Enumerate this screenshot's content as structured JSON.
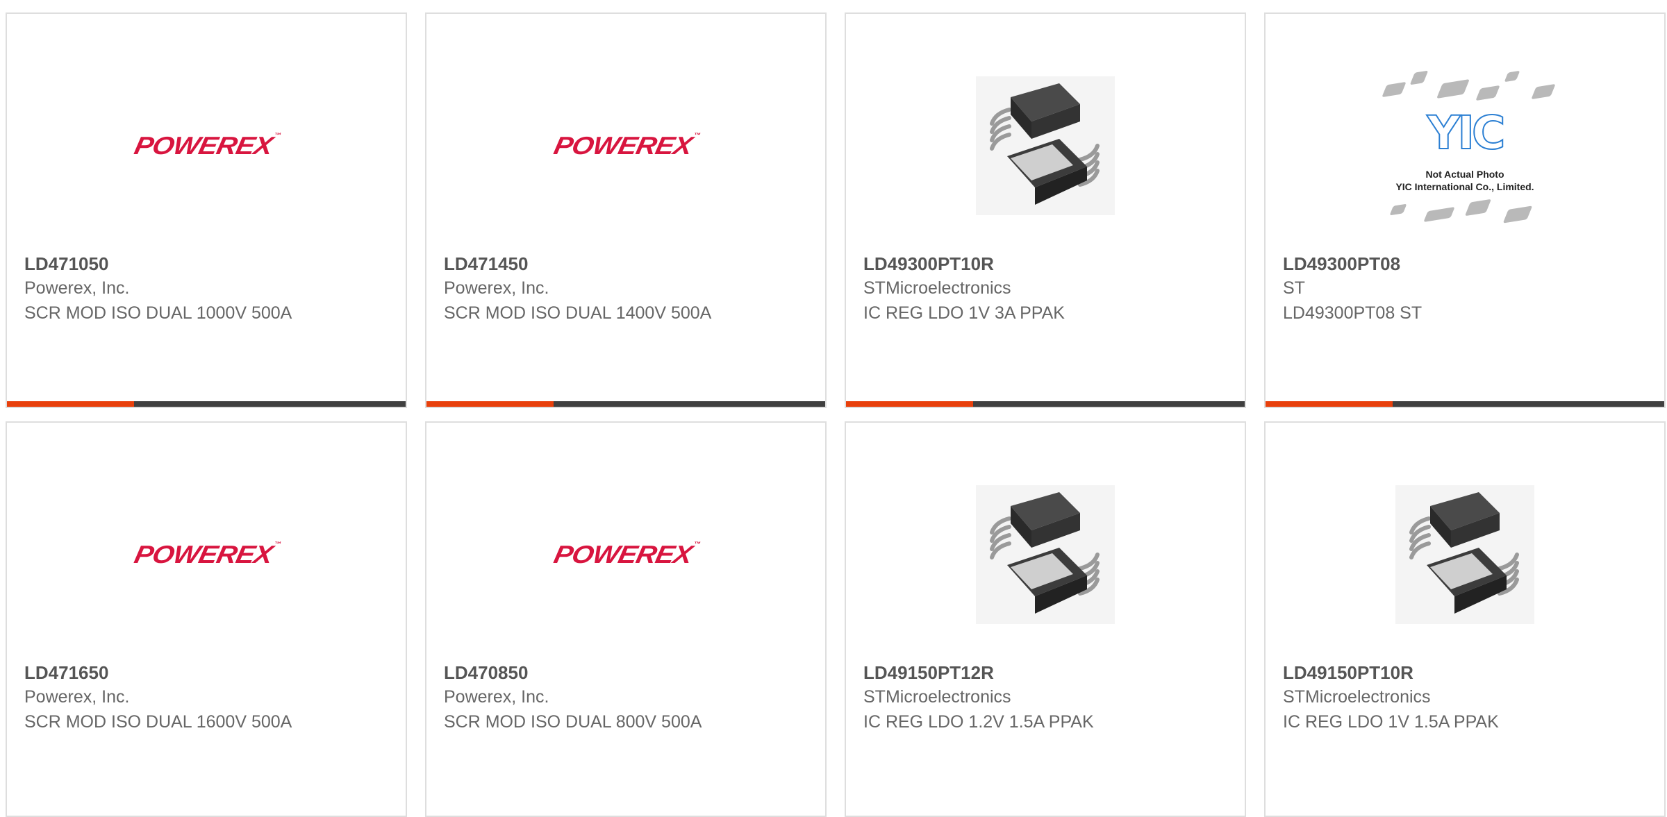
{
  "products": [
    {
      "part_number": "LD471050",
      "manufacturer": "Powerex, Inc.",
      "description": "SCR MOD ISO DUAL 1000V 500A",
      "image": "powerex-logo",
      "logo_text": "POWEREX"
    },
    {
      "part_number": "LD471450",
      "manufacturer": "Powerex, Inc.",
      "description": "SCR MOD ISO DUAL 1400V 500A",
      "image": "powerex-logo",
      "logo_text": "POWEREX"
    },
    {
      "part_number": "LD49300PT10R",
      "manufacturer": "STMicroelectronics",
      "description": "IC REG LDO 1V 3A PPAK",
      "image": "ppak-chip-photo"
    },
    {
      "part_number": "LD49300PT08",
      "manufacturer": "ST",
      "description": "LD49300PT08 ST",
      "image": "yic-placeholder",
      "logo_text": "YIC",
      "caption_1": "Not Actual Photo",
      "caption_2": "YIC International Co., Limited."
    },
    {
      "part_number": "LD471650",
      "manufacturer": "Powerex, Inc.",
      "description": "SCR MOD ISO DUAL 1600V 500A",
      "image": "powerex-logo",
      "logo_text": "POWEREX"
    },
    {
      "part_number": "LD470850",
      "manufacturer": "Powerex, Inc.",
      "description": "SCR MOD ISO DUAL 800V 500A",
      "image": "powerex-logo",
      "logo_text": "POWEREX"
    },
    {
      "part_number": "LD49150PT12R",
      "manufacturer": "STMicroelectronics",
      "description": "IC REG LDO 1.2V 1.5A PPAK",
      "image": "ppak-chip-photo"
    },
    {
      "part_number": "LD49150PT10R",
      "manufacturer": "STMicroelectronics",
      "description": "IC REG LDO 1V 1.5A PPAK",
      "image": "ppak-chip-photo"
    }
  ],
  "colors": {
    "accent": "#e8400c",
    "bar_dark": "#404040",
    "powerex_red": "#d8153f",
    "yic_blue": "#2b7fd3",
    "text_gray": "#666666"
  }
}
